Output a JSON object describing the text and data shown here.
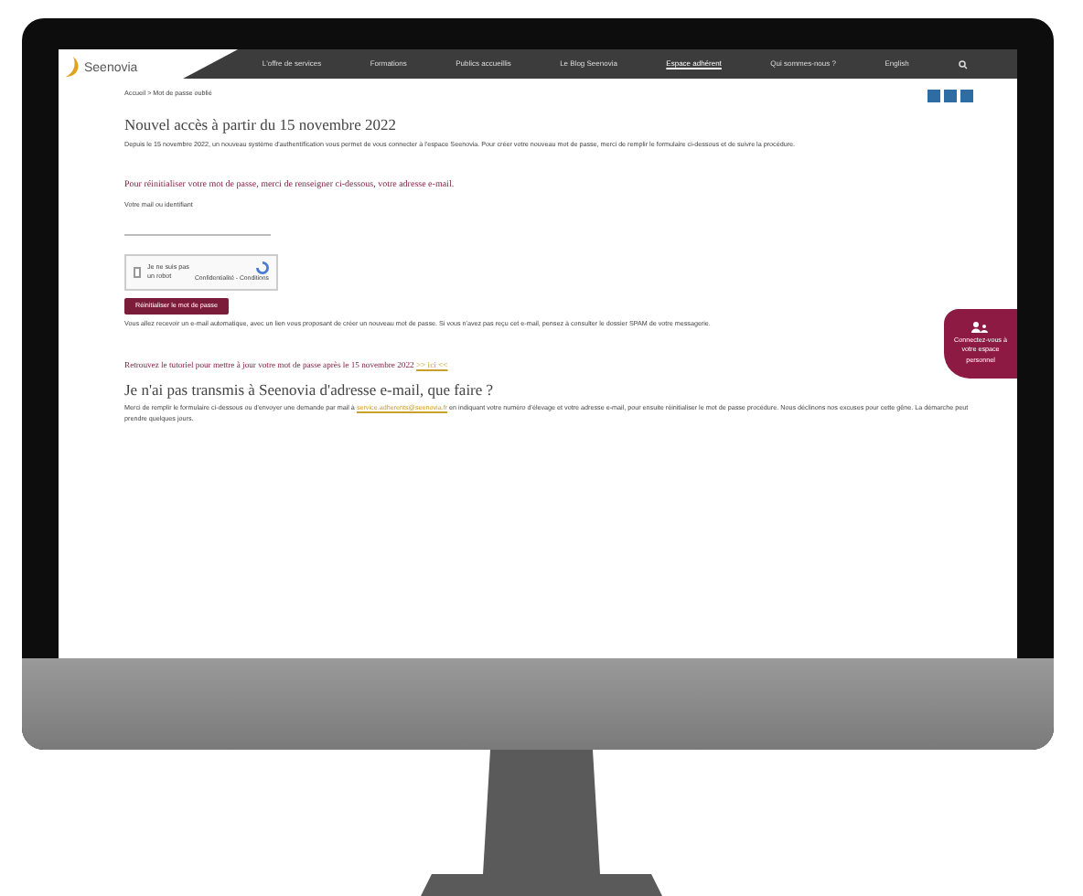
{
  "site": {
    "logo": "Seenovia",
    "nav": [
      {
        "label": "L'offre de services",
        "selected": false
      },
      {
        "label": "Formations",
        "selected": false
      },
      {
        "label": "Publics accueillis",
        "selected": false
      },
      {
        "label": "Le Blog Seenovia",
        "selected": false
      },
      {
        "label": "Espace adhérent",
        "selected": true
      },
      {
        "label": "Qui sommes-nous ?",
        "selected": false
      },
      {
        "label": "English",
        "selected": false
      }
    ]
  },
  "breadcrumb": "Accueil > Mot de passe oublié",
  "title": "Nouvel accès à partir du 15 novembre 2022",
  "intro": "Depuis le 15 novembre 2022, un nouveau système d'authentification vous permet de vous connecter à l'espace Seenovia. Pour créer votre nouveau mot de passe, merci de remplir le formulaire ci-dessous et de suivre la procédure.",
  "form": {
    "instruction": "Pour réinitialiser votre mot de passe, merci de renseigner ci-dessous, votre adresse e-mail.",
    "field_label": "Votre mail ou identifiant",
    "captcha": {
      "label": "Je ne suis pas un robot",
      "checked": false,
      "footer": "Confidentialité - Conditions"
    },
    "submit": "Réinitialiser le mot de passe",
    "note": "Vous allez recevoir un e-mail automatique, avec un lien vous proposant de créer un nouveau mot de passe. Si vous n'avez pas reçu cet e-mail, pensez à consulter le dossier SPAM de votre messagerie."
  },
  "tutorial": {
    "text": "Retrouvez le tutoriel pour mettre à jour votre mot de passe après le 15 novembre 2022",
    "link": ">> ici <<"
  },
  "faq": {
    "title": "Je n'ai pas transmis à Seenovia d'adresse e-mail, que faire ?",
    "before": "Merci de remplir le formulaire ci-dessous ou d'envoyer une demande par mail à",
    "link": "service.adherents@seenovia.fr",
    "after": "en indiquant votre numéro d'élevage et votre adresse e-mail, pour ensuite réinitialiser le mot de passe procédure. Nous déclinons nos excuses pour cette gêne. La démarche peut prendre quelques jours."
  },
  "floating": {
    "label": "Connectez-vous à votre espace personnel"
  }
}
